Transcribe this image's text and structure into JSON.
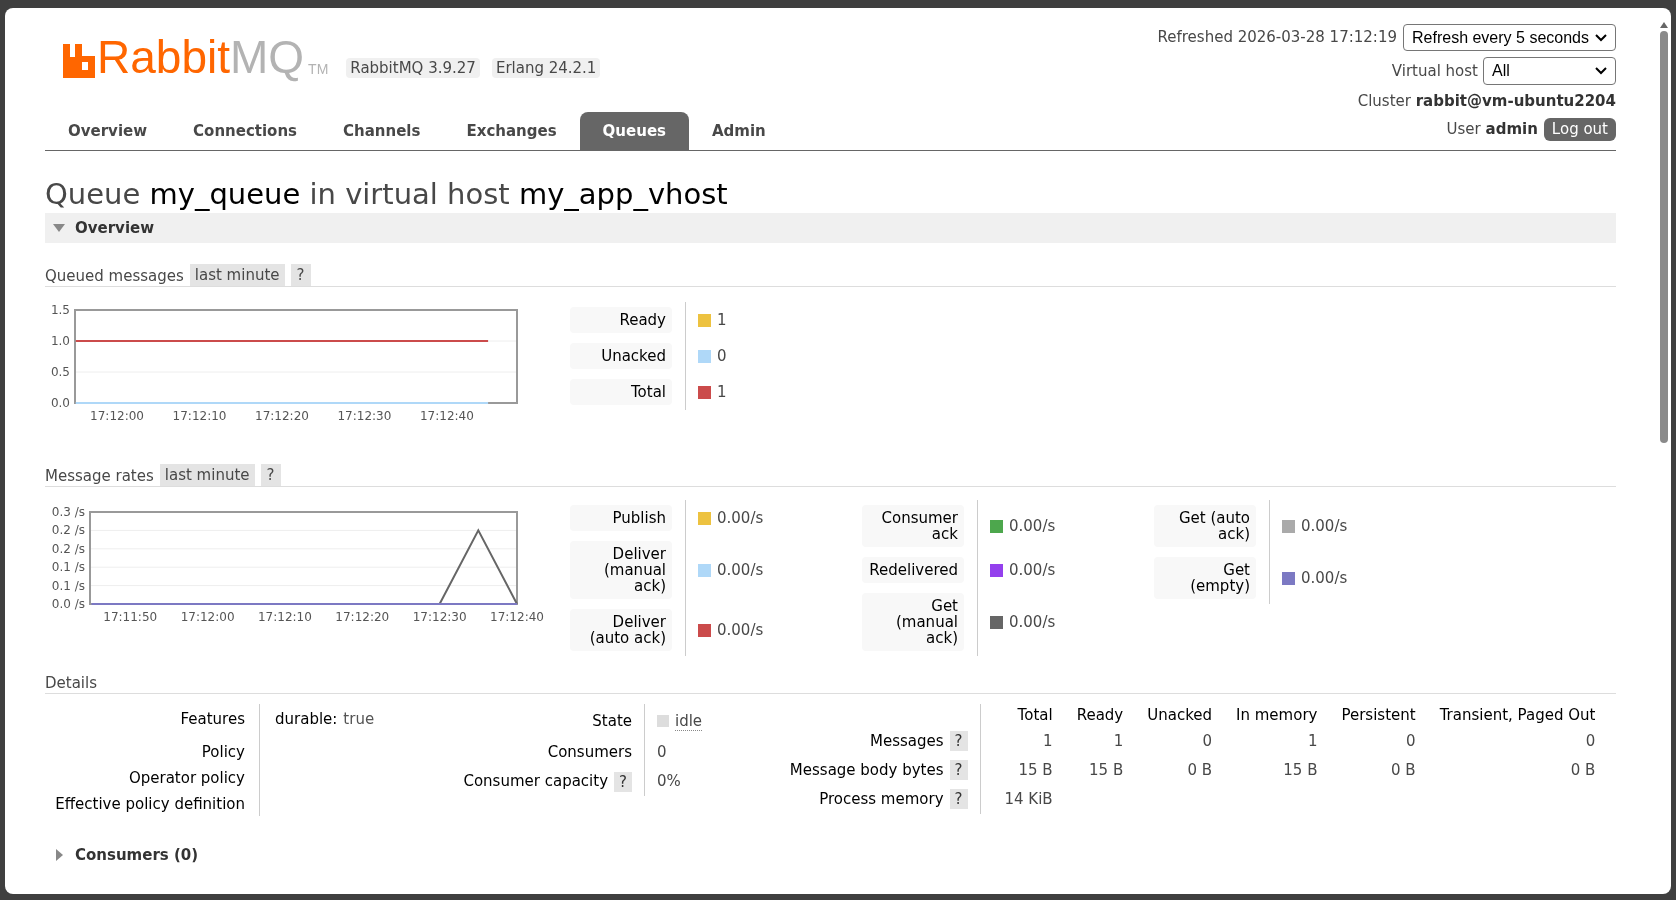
{
  "logo": {
    "word_1": "Rabbit",
    "word_2": "MQ",
    "mark": "TM"
  },
  "versions": [
    "RabbitMQ 3.9.27",
    "Erlang 24.2.1"
  ],
  "refreshed": "Refreshed 2026-03-28 17:12:19",
  "refresh_select": "Refresh every 5 seconds",
  "virtual_host": {
    "label": "Virtual host",
    "value": "All"
  },
  "cluster": "Cluster **rabbit@vm-ubuntu2204**",
  "user": "User **admin**",
  "logout_button": "Log out",
  "tabs": [
    {
      "label": "Overview",
      "selected": false
    },
    {
      "label": "Connections",
      "selected": false
    },
    {
      "label": "Channels",
      "selected": false
    },
    {
      "label": "Exchanges",
      "selected": false
    },
    {
      "label": "Queues",
      "selected": true
    },
    {
      "label": "Admin",
      "selected": false
    }
  ],
  "title": [
    {
      "text": "Queue",
      "emphasis": false
    },
    {
      "text": "my_queue",
      "emphasis": true
    },
    {
      "text": "in virtual host",
      "emphasis": false
    },
    {
      "text": "my_app_vhost",
      "emphasis": true
    }
  ],
  "overview_section": {
    "label": "Overview",
    "expanded": true
  },
  "queued_messages": {
    "title": "Queued messages",
    "range": "last minute",
    "help": "?",
    "chart_data": {
      "type": "line",
      "grid": true,
      "categories": [
        null,
        "17:12:00",
        null,
        "17:12:10",
        null,
        "17:12:20",
        null,
        "17:12:30",
        null,
        "17:12:40",
        null
      ],
      "ylim": [
        0,
        1.5
      ],
      "yticks": [
        {
          "value": 0,
          "label": "0.0"
        },
        {
          "value": 0.5,
          "label": "0.5"
        },
        {
          "value": 1,
          "label": "1.0"
        },
        {
          "value": 1.5,
          "label": "1.5"
        }
      ],
      "series": [
        {
          "name": "Unacked",
          "color": "#afd8f8",
          "values": [
            0,
            0,
            0,
            0,
            0,
            0,
            0,
            0,
            0,
            0,
            0
          ]
        },
        {
          "name": "Total",
          "color": "#cb4b4b",
          "values": [
            1,
            1,
            1,
            1,
            1,
            1,
            1,
            1,
            1,
            1,
            1
          ]
        }
      ]
    },
    "legend_groups": [
      [
        {
          "kind": "plain",
          "label": "Ready",
          "value": "1",
          "color": "#edc240"
        },
        {
          "kind": "series",
          "value": "0"
        },
        {
          "kind": "series",
          "value": "1"
        }
      ]
    ]
  },
  "message_rates": {
    "title": "Message rates",
    "range": "last minute",
    "help": "?",
    "chart_data": {
      "type": "line",
      "grid": true,
      "categories": [
        null,
        "17:11:50",
        null,
        "17:12:00",
        null,
        "17:12:10",
        null,
        "17:12:20",
        null,
        "17:12:30",
        null,
        "17:12:40"
      ],
      "ylim": [
        0,
        0.25
      ],
      "yticks": [
        {
          "value": 0,
          "label": "0.0 /s"
        },
        {
          "value": 0.05,
          "label": "0.1 /s"
        },
        {
          "value": 0.1,
          "label": "0.1 /s"
        },
        {
          "value": 0.15,
          "label": "0.2 /s"
        },
        {
          "value": 0.2,
          "label": "0.2 /s"
        },
        {
          "value": 0.25,
          "label": "0.3 /s"
        }
      ],
      "series": [
        {
          "name": "Get (manual ack)",
          "color": "#666666",
          "values": [
            null,
            null,
            null,
            null,
            null,
            null,
            null,
            null,
            null,
            0,
            0.2,
            0
          ]
        },
        {
          "name": "Get (empty)",
          "color": "#7c79c3",
          "values": [
            0,
            0,
            0,
            0,
            0,
            0,
            0,
            0,
            0,
            0,
            0,
            0
          ]
        }
      ]
    },
    "legend_groups": [
      [
        {
          "kind": "plain",
          "label": "Publish",
          "value": "0.00/s",
          "color": "#edc240"
        },
        {
          "kind": "plain",
          "label": "Deliver (manual ack)",
          "value": "0.00/s",
          "color": "#afd8f8"
        },
        {
          "kind": "plain",
          "label": "Deliver (auto ack)",
          "value": "0.00/s",
          "color": "#cb4b4b"
        }
      ],
      [
        {
          "kind": "plain",
          "label": "Consumer ack",
          "value": "0.00/s",
          "color": "#4da74d"
        },
        {
          "kind": "plain",
          "label": "Redelivered",
          "value": "0.00/s",
          "color": "#9440ed"
        },
        {
          "kind": "series",
          "value": "0.00/s"
        }
      ],
      [
        {
          "kind": "plain",
          "label": "Get (auto ack)",
          "value": "0.00/s",
          "color": "#aaaaaa"
        },
        {
          "kind": "series",
          "value": "0.00/s"
        }
      ]
    ]
  },
  "details": {
    "title": "Details",
    "properties": [
      {
        "label": "Features",
        "key": "durable:",
        "value": "true"
      },
      {
        "label": "Policy"
      },
      {
        "label": "Operator policy"
      },
      {
        "label": "Effective policy definition"
      }
    ],
    "status": [
      {
        "label": "State",
        "value": "idle",
        "kind": "state"
      },
      {
        "label": "Consumers",
        "value": "0",
        "kind": "plain"
      },
      {
        "label": "Consumer capacity",
        "help": "?",
        "value": "0%",
        "kind": "plain"
      }
    ],
    "message_table": {
      "columns": [
        "Total",
        "Ready",
        "Unacked",
        "In memory",
        "Persistent",
        "Transient, Paged Out"
      ],
      "rows": [
        {
          "label": "Messages",
          "help": "?",
          "cells": [
            "1",
            "1",
            "0",
            "1",
            "0",
            "0"
          ]
        },
        {
          "label": "Message body bytes",
          "help": "?",
          "cells": [
            "15 B",
            "15 B",
            "0 B",
            "15 B",
            "0 B",
            "0 B"
          ]
        },
        {
          "label": "Process memory",
          "help": "?",
          "cells": [
            "14 KiB"
          ]
        }
      ]
    }
  },
  "consumers_section": {
    "label": "Consumers (0)",
    "expanded": false
  }
}
